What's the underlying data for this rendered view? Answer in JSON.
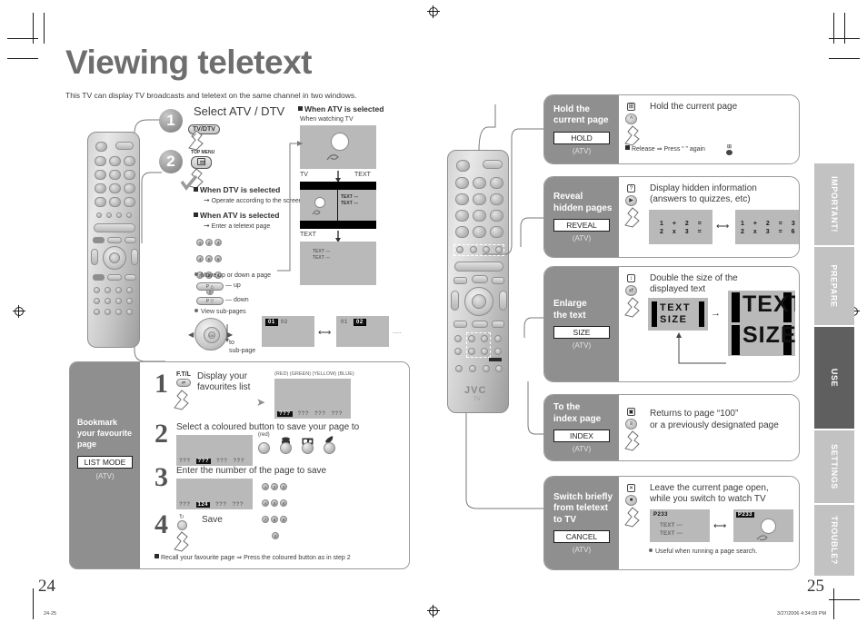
{
  "document": {
    "title": "Viewing teletext",
    "lede": "This TV can display TV broadcasts and teletext on the same channel in two windows.",
    "left_folio": "24",
    "right_folio": "25",
    "footer_left": "24-25",
    "footer_right": "3/27/2006   4:34:09 PM",
    "brand": "JVC",
    "brand_sub": "TV"
  },
  "select_section": {
    "heading": "Select ATV / DTV",
    "steps": [
      {
        "num": "1",
        "key": "TV/DTV",
        "caption": ""
      },
      {
        "num": "2",
        "key_top": "TOP MENU",
        "key": "menu-icon",
        "caption": ""
      }
    ],
    "dtv": {
      "heading": "When DTV is selected",
      "bullet": "Operate according to the screen indications"
    },
    "atv": {
      "heading": "When ATV is selected",
      "bullet": "Enter a teletext page",
      "keypad": [
        "1",
        "2",
        "3",
        "4",
        "5",
        "6",
        "7",
        "8",
        "9",
        "0"
      ],
      "move_label": "Move up or down a page",
      "up_label": "up",
      "down_label": "down",
      "subpages_label": "View sub-pages",
      "to_subpage": "to\nsub-page",
      "subpage_a_active": "01",
      "subpage_a_inactive": "02",
      "subpage_b_inactive": "01",
      "subpage_b_active": "02",
      "ellipsis": "....."
    }
  },
  "atv_screens": {
    "heading": "When ATV is selected",
    "sub": "When watching TV",
    "label_tv": "TV",
    "label_text_right": "TEXT",
    "label_text": "TEXT",
    "text_lines": [
      "TEXT ---",
      "TEXT ---"
    ]
  },
  "bookmark": {
    "title_lines": [
      "Bookmark",
      "your favourite",
      "page"
    ],
    "mode": "LIST MODE",
    "atv": "(ATV)",
    "steps": [
      {
        "num": "1",
        "key_label": "F.T/L",
        "text": "Display your\nfavourites list",
        "colour_legend": "(RED) (GREEN) (YELLOW) (BLUE)",
        "slots": [
          "???",
          "???",
          "???",
          "???"
        ],
        "active_slot": 0
      },
      {
        "num": "2",
        "text": "Select a coloured button to save your page to",
        "slots": [
          "???",
          "???",
          "???",
          "???"
        ],
        "active_slot": 1,
        "red_label": "(red)"
      },
      {
        "num": "3",
        "text": "Enter the number of the page to save",
        "slots": [
          "???",
          "124",
          "???",
          "???"
        ],
        "active_slot": 1,
        "keypad": [
          "1",
          "2",
          "3",
          "4",
          "5",
          "6",
          "7",
          "8",
          "9",
          "0"
        ]
      },
      {
        "num": "4",
        "text": "Save"
      }
    ],
    "footnote": "Recall your favourite page  ⇒  Press the coloured button as in step 2"
  },
  "panels": [
    {
      "id": "hold",
      "title_lines": [
        "Hold the",
        "current page"
      ],
      "button": "HOLD",
      "atv": "(ATV)",
      "headline": "Hold the current page",
      "note": "Release  ⇒  Press “    ” again"
    },
    {
      "id": "reveal",
      "title_lines": [
        "Reveal",
        "hidden pages"
      ],
      "button": "REVEAL",
      "atv": "(ATV)",
      "headline": "Display hidden information\n(answers to quizzes, etc)",
      "math_before": [
        [
          "1",
          "+",
          "2",
          "="
        ],
        [
          "2",
          "x",
          "3",
          "="
        ]
      ],
      "math_after": [
        [
          "1",
          "+",
          "2",
          "=",
          "3"
        ],
        [
          "2",
          "x",
          "3",
          "=",
          "6"
        ]
      ]
    },
    {
      "id": "size",
      "title_lines": [
        "Enlarge",
        "the text"
      ],
      "button": "SIZE",
      "atv": "(ATV)",
      "headline": "Double the size of the\ndisplayed text",
      "screen_small": [
        "TEXT",
        "SIZE"
      ],
      "screen_top": "TEXT",
      "screen_bottom": "SIZE"
    },
    {
      "id": "index",
      "title_lines": [
        "To the",
        "index page"
      ],
      "button": "INDEX",
      "atv": "(ATV)",
      "headline": "Returns to page “100”\nor a previously designated page"
    },
    {
      "id": "cancel",
      "title_lines": [
        "Switch briefly",
        "from teletext",
        "to TV"
      ],
      "button": "CANCEL",
      "atv": "(ATV)",
      "headline": "Leave the current page open,\nwhile you switch to watch TV",
      "page_label": "P233",
      "text_lines": [
        "TEXT ---",
        "TEXT ---"
      ],
      "note": "Useful when running a page search."
    }
  ],
  "side_tabs": [
    {
      "label": "IMPORTANT!",
      "active": false
    },
    {
      "label": "PREPARE",
      "active": false
    },
    {
      "label": "USE",
      "active": true
    },
    {
      "label": "SETTINGS",
      "active": false
    },
    {
      "label": "TROUBLE?",
      "active": false
    }
  ]
}
